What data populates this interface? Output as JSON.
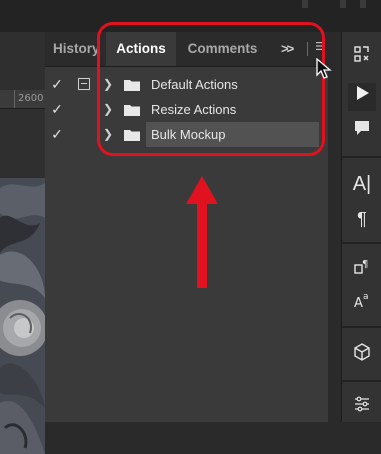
{
  "panel": {
    "tabs": [
      {
        "label": "History"
      },
      {
        "label": "Actions"
      },
      {
        "label": "Comments"
      }
    ],
    "overflow_label": ">>",
    "menu_icon": "hamburger-icon"
  },
  "ruler": {
    "label": "2600"
  },
  "actions": [
    {
      "label": "Default Actions",
      "checked": true,
      "dialog_toggle": true
    },
    {
      "label": "Resize Actions",
      "checked": true,
      "dialog_toggle": false
    },
    {
      "label": "Bulk Mockup",
      "checked": true,
      "dialog_toggle": false,
      "selected": true
    }
  ],
  "toolbar": {
    "icons": [
      "history-brush-icon",
      "play-icon",
      "comment-icon",
      "type-icon",
      "paragraph-icon",
      "character-styles-icon",
      "paragraph-styles-icon",
      "3d-cube-icon",
      "adjustments-icon"
    ]
  },
  "colors": {
    "highlight": "#e0121f",
    "panel_bg": "#3a3a3a",
    "selection": "#525252"
  }
}
